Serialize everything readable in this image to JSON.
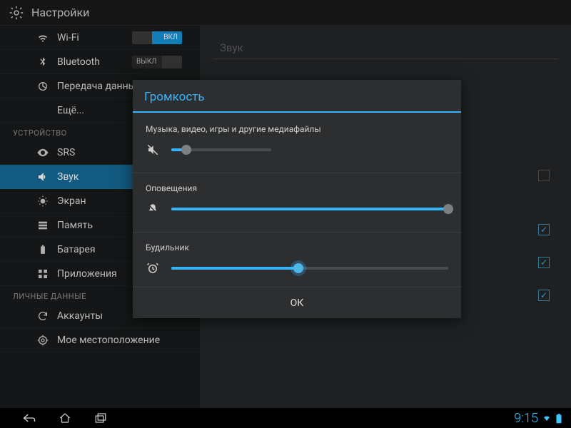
{
  "colors": {
    "accent": "#35b5ff",
    "activeRow": "#166a96"
  },
  "topbar": {
    "title": "Настройки"
  },
  "sidebar": {
    "groups": [
      {
        "header": null,
        "items": [
          {
            "id": "wifi",
            "icon": "wifi-icon",
            "label": "Wi-Fi",
            "toggle": {
              "state": "on",
              "text": "ВКЛ"
            }
          },
          {
            "id": "bluetooth",
            "icon": "bluetooth-icon",
            "label": "Bluetooth",
            "toggle": {
              "state": "off",
              "text": "ВЫКЛ"
            }
          },
          {
            "id": "data",
            "icon": "data-usage-icon",
            "label": "Передача данных"
          },
          {
            "id": "more",
            "icon": null,
            "label": "Ещё..."
          }
        ]
      },
      {
        "header": "УСТРОЙСТВО",
        "items": [
          {
            "id": "srs",
            "icon": "eye-icon",
            "label": "SRS"
          },
          {
            "id": "sound",
            "icon": "volume-icon",
            "label": "Звук",
            "active": true
          },
          {
            "id": "display",
            "icon": "brightness-icon",
            "label": "Экран"
          },
          {
            "id": "storage",
            "icon": "storage-icon",
            "label": "Память"
          },
          {
            "id": "battery",
            "icon": "battery-icon",
            "label": "Батарея"
          },
          {
            "id": "apps",
            "icon": "apps-icon",
            "label": "Приложения"
          }
        ]
      },
      {
        "header": "ЛИЧНЫЕ ДАННЫЕ",
        "items": [
          {
            "id": "accounts",
            "icon": "sync-icon",
            "label": "Аккаунты"
          },
          {
            "id": "location",
            "icon": "location-icon",
            "label": "Мое местоположение"
          }
        ]
      }
    ]
  },
  "main": {
    "sectionTitle": "Звук",
    "rows": [
      {
        "label": "",
        "checked": false
      },
      {
        "label": "",
        "checked": true
      },
      {
        "label": "",
        "checked": true
      },
      {
        "label": "",
        "checked": true
      }
    ]
  },
  "dialog": {
    "title": "Громкость",
    "groups": [
      {
        "label": "Музыка, видео, игры и другие медиафайлы",
        "icon": "media-mute-icon",
        "valuePct": 15,
        "thumb": "dim"
      },
      {
        "label": "Оповещения",
        "icon": "notification-mute-icon",
        "valuePct": 100,
        "thumb": "dim"
      },
      {
        "label": "Будильник",
        "icon": "alarm-icon",
        "valuePct": 46,
        "thumb": "accent"
      }
    ],
    "okLabel": "ОК"
  },
  "navbar": {
    "buttons": [
      "back-icon",
      "home-icon",
      "recent-icon"
    ],
    "clock": "9:15",
    "status": [
      "wifi-status-icon",
      "battery-status-icon"
    ]
  }
}
